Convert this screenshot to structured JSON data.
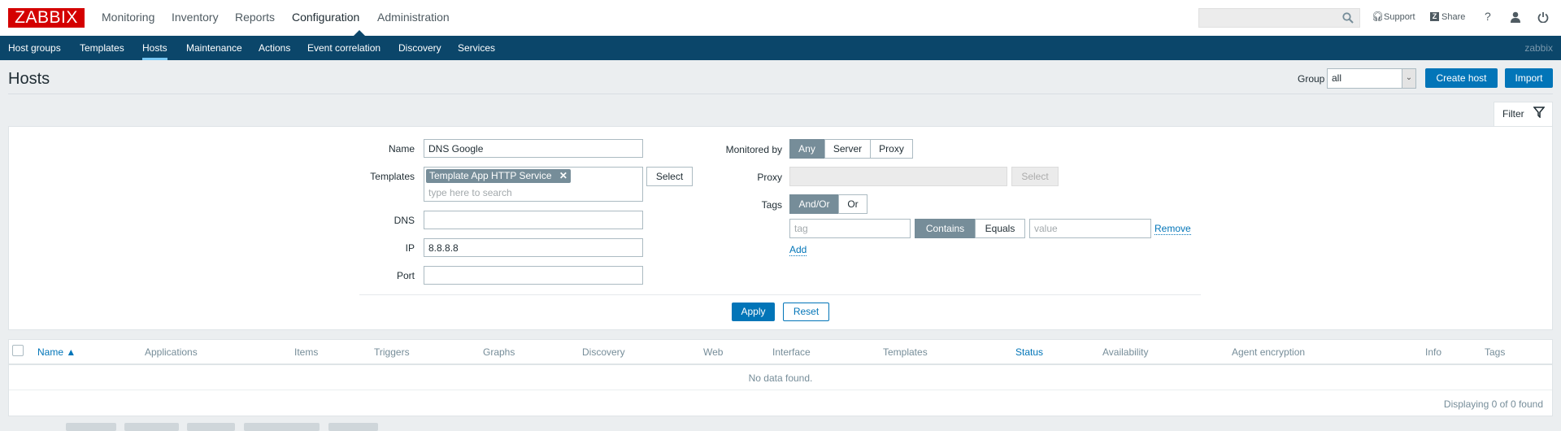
{
  "logo": "ZABBIX",
  "top_nav": [
    "Monitoring",
    "Inventory",
    "Reports",
    "Configuration",
    "Administration"
  ],
  "top_right": {
    "search_value": "",
    "support": "Support",
    "share": "Share",
    "help": "?"
  },
  "sub_nav": [
    "Host groups",
    "Templates",
    "Hosts",
    "Maintenance",
    "Actions",
    "Event correlation",
    "Discovery",
    "Services"
  ],
  "username": "zabbix",
  "page": {
    "title": "Hosts",
    "group_label": "Group",
    "group_value": "all",
    "create_host": "Create host",
    "import": "Import",
    "filter_tab": "Filter"
  },
  "filter": {
    "name_label": "Name",
    "name_value": "DNS Google",
    "templates_label": "Templates",
    "template_chip": "Template App HTTP Service",
    "templates_placeholder": "type here to search",
    "select": "Select",
    "dns_label": "DNS",
    "dns_value": "",
    "ip_label": "IP",
    "ip_value": "8.8.8.8",
    "port_label": "Port",
    "port_value": "",
    "monitored_label": "Monitored by",
    "monitored_options": [
      "Any",
      "Server",
      "Proxy"
    ],
    "proxy_label": "Proxy",
    "proxy_select": "Select",
    "tags_label": "Tags",
    "tags_options": [
      "And/Or",
      "Or"
    ],
    "tag_placeholder": "tag",
    "operators": [
      "Contains",
      "Equals"
    ],
    "value_placeholder": "value",
    "remove": "Remove",
    "add": "Add",
    "apply": "Apply",
    "reset": "Reset"
  },
  "table": {
    "columns": [
      "Name ▲",
      "Applications",
      "Items",
      "Triggers",
      "Graphs",
      "Discovery",
      "Web",
      "Interface",
      "Templates",
      "Status",
      "Availability",
      "Agent encryption",
      "Info",
      "Tags"
    ],
    "empty": "No data found.",
    "footer": "Displaying 0 of 0 found"
  },
  "colors": {
    "brand": "#d40000",
    "nav": "#0b466a",
    "primary": "#0275b8",
    "segment_active": "#768d99"
  }
}
